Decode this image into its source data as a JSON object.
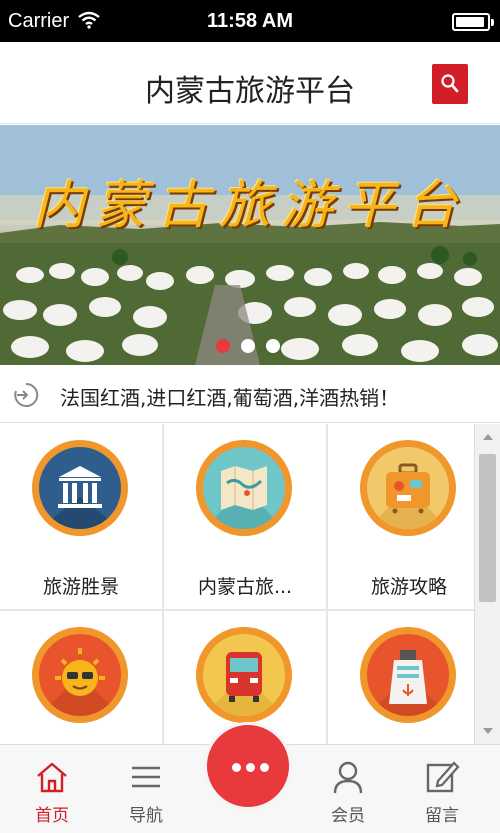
{
  "status_bar": {
    "carrier": "Carrier",
    "time": "11:58 AM"
  },
  "header": {
    "title": "内蒙古旅游平台",
    "search_icon": "search-icon"
  },
  "banner": {
    "caption": "内蒙古旅游平台",
    "slide_count": 3,
    "active_slide": 1
  },
  "notice": {
    "icon": "announcement-icon",
    "text": "法国红酒,进口红酒,葡萄酒,洋酒热销！"
  },
  "grid": {
    "items": [
      {
        "label": "旅游胜景",
        "icon": "museum-icon",
        "color": "#2f5e8c"
      },
      {
        "label": "内蒙古旅...",
        "icon": "map-icon",
        "color": "#6ec6c9"
      },
      {
        "label": "旅游攻略",
        "icon": "suitcase-icon",
        "color": "#f2c96a"
      },
      {
        "label": "",
        "icon": "sun-icon",
        "color": "#e8542b"
      },
      {
        "label": "",
        "icon": "bus-icon",
        "color": "#f3c64f"
      },
      {
        "label": "",
        "icon": "ship-icon",
        "color": "#e8542b"
      }
    ]
  },
  "tabbar": {
    "home": "首页",
    "nav": "导航",
    "member": "会员",
    "message": "留言"
  },
  "colors": {
    "accent": "#d21e26",
    "icon_ring": "#f0962a",
    "center_button": "#e8393c"
  }
}
